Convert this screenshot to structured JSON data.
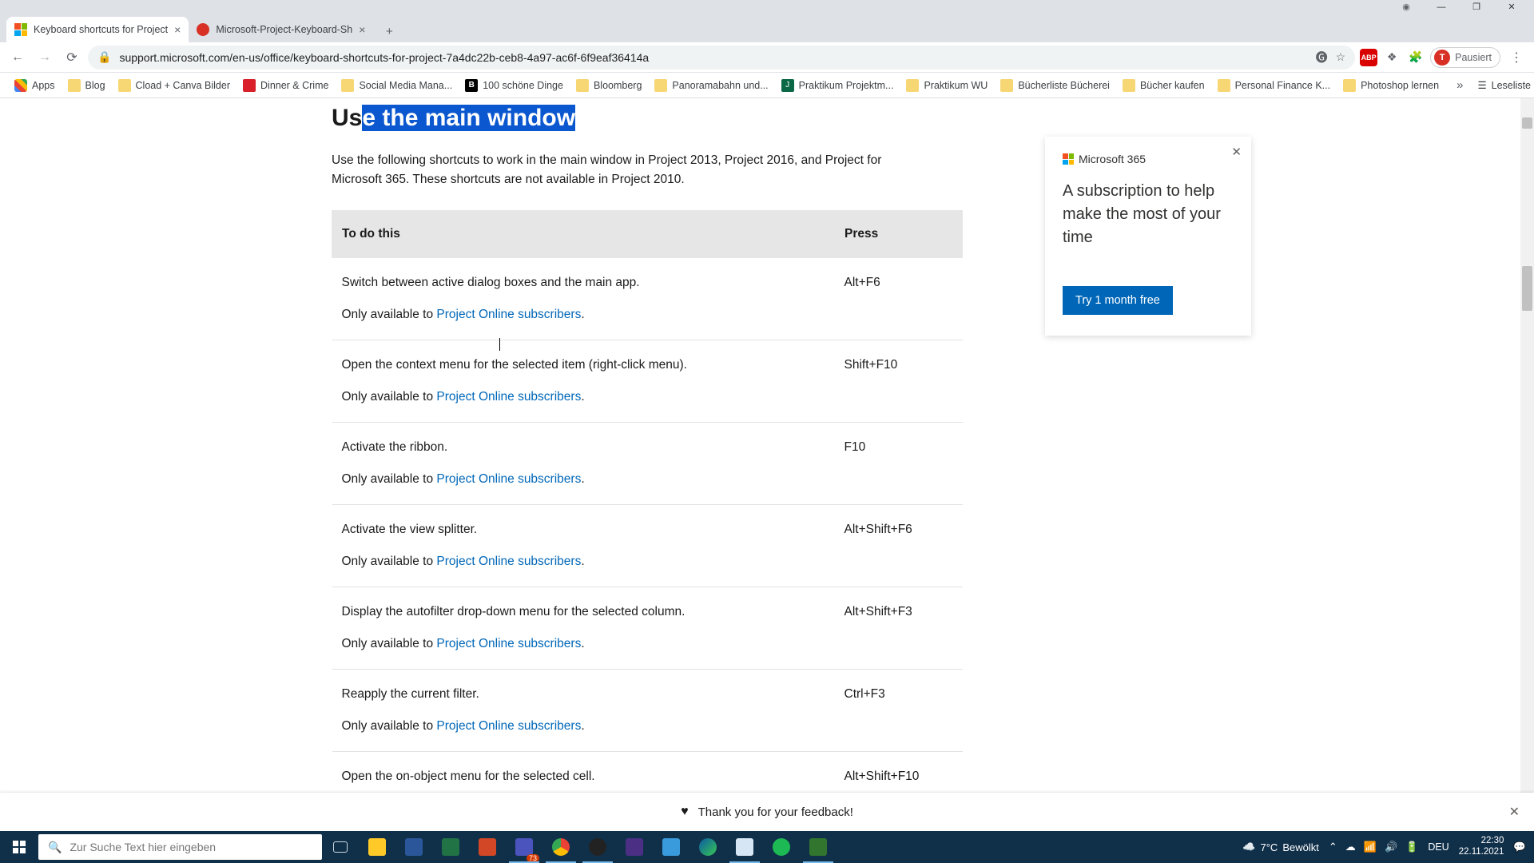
{
  "browser": {
    "tabs": [
      {
        "title": "Keyboard shortcuts for Project",
        "active": true
      },
      {
        "title": "Microsoft-Project-Keyboard-Sh",
        "active": false
      }
    ],
    "url": "support.microsoft.com/en-us/office/keyboard-shortcuts-for-project-7a4dc22b-ceb8-4a97-ac6f-6f9eaf36414a",
    "profile_label": "Pausiert",
    "profile_initial": "T"
  },
  "bookmarks": {
    "items": [
      "Apps",
      "Blog",
      "Cload + Canva Bilder",
      "Dinner & Crime",
      "Social Media Mana...",
      "100 schöne Dinge",
      "Bloomberg",
      "Panoramabahn und...",
      "Praktikum Projektm...",
      "Praktikum WU",
      "Bücherliste Bücherei",
      "Bücher kaufen",
      "Personal Finance K...",
      "Photoshop lernen"
    ],
    "reading_list": "Leseliste"
  },
  "article": {
    "heading_prefix": "Us",
    "heading_selected": "e the main window",
    "intro": "Use the following shortcuts to work in the main window in Project 2013, Project 2016, and Project for Microsoft 365. These shortcuts are not available in Project 2010.",
    "cols": {
      "action": "To do this",
      "press": "Press"
    },
    "avail_prefix": "Only available to ",
    "link_text": "Project Online subscribers",
    "rows": [
      {
        "action": "Switch between active dialog boxes and the main app.",
        "press": "Alt+F6"
      },
      {
        "action": "Open the context menu for the selected item (right-click menu).",
        "press": "Shift+F10"
      },
      {
        "action": "Activate the ribbon.",
        "press": "F10"
      },
      {
        "action": "Activate the view splitter.",
        "press": "Alt+Shift+F6"
      },
      {
        "action": "Display the autofilter drop-down menu for the selected column.",
        "press": "Alt+Shift+F3"
      },
      {
        "action": "Reapply the current filter.",
        "press": "Ctrl+F3"
      },
      {
        "action": "Open the on-object menu for the selected cell.",
        "press": "Alt+Shift+F10"
      }
    ]
  },
  "promo": {
    "brand": "Microsoft 365",
    "text": "A subscription to help make the most of your time",
    "button": "Try 1 month free"
  },
  "feedback": {
    "text": "Thank you for your feedback!"
  },
  "taskbar": {
    "search_placeholder": "Zur Suche Text hier eingeben",
    "weather_temp": "7°C",
    "weather_desc": "Bewölkt",
    "lang": "DEU",
    "time": "22:30",
    "date": "22.11.2021",
    "teams_badge": "73"
  }
}
